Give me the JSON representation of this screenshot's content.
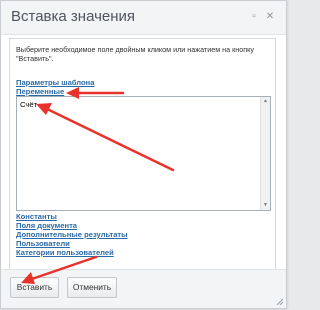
{
  "dialog": {
    "title": "Вставка значения",
    "buttons": {
      "minimize_icon": "▫",
      "close_icon": "✕"
    }
  },
  "hint": "Выберите необходимое поле двойным кликом или нажатием на кнопку \"Вставить\".",
  "top_links": [
    "Параметры шаблона",
    "Переменные"
  ],
  "list": {
    "items": [
      "Счёт"
    ]
  },
  "bottom_links": [
    "Константы",
    "Поля документа",
    "Дополнительные результаты",
    "Пользователи",
    "Категории пользователей"
  ],
  "footer": {
    "insert_label": "Вставить",
    "cancel_label": "Отменить"
  },
  "colors": {
    "link": "#2a6aa8",
    "annotation_arrow": "#e8322b"
  }
}
